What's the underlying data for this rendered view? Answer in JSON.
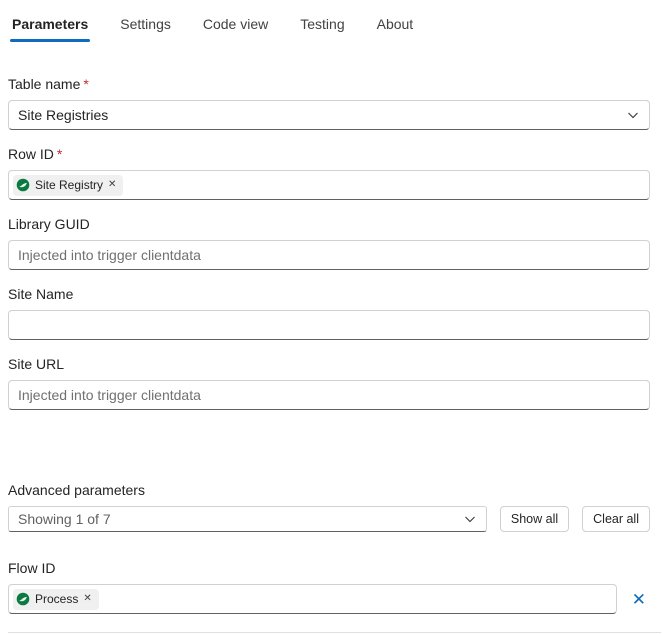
{
  "tabs": [
    {
      "label": "Parameters"
    },
    {
      "label": "Settings"
    },
    {
      "label": "Code view"
    },
    {
      "label": "Testing"
    },
    {
      "label": "About"
    }
  ],
  "fields": {
    "table_name": {
      "label": "Table name",
      "required": "*",
      "value": "Site Registries"
    },
    "row_id": {
      "label": "Row ID",
      "required": "*",
      "token": "Site Registry"
    },
    "library_guid": {
      "label": "Library GUID",
      "placeholder": "Injected into trigger clientdata"
    },
    "site_name": {
      "label": "Site Name"
    },
    "site_url": {
      "label": "Site URL",
      "placeholder": "Injected into trigger clientdata"
    }
  },
  "advanced": {
    "label": "Advanced parameters",
    "value": "Showing 1 of 7",
    "show_all_label": "Show all",
    "clear_all_label": "Clear all"
  },
  "flow_id": {
    "label": "Flow ID",
    "token": "Process"
  },
  "icons": {
    "dismiss": "✕",
    "clear": "✕"
  },
  "colors": {
    "accent": "#0f6cbd",
    "required": "#bc2f32",
    "token_green": "#0b7a40"
  }
}
